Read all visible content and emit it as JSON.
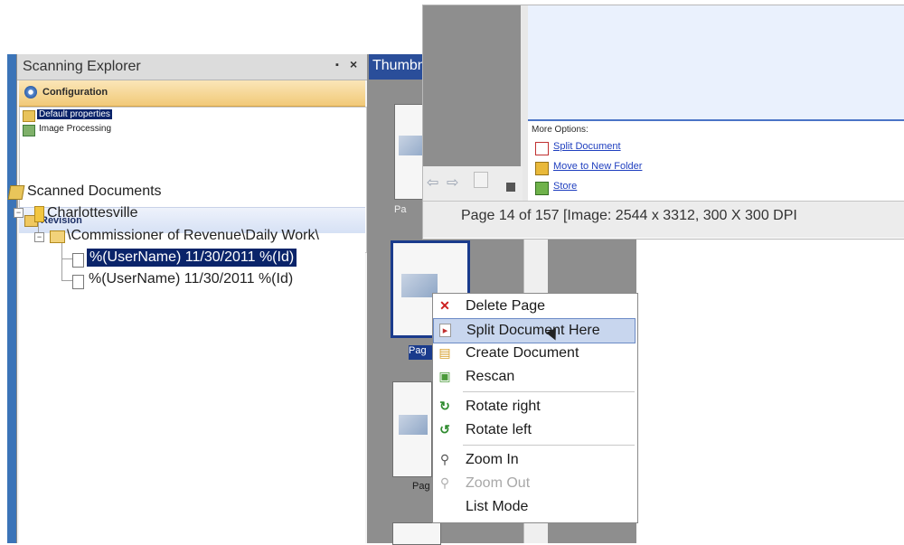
{
  "explorer": {
    "title": "Scanning Explorer",
    "pin_glyph": "▪",
    "close_glyph": "×",
    "configuration": {
      "label": "Configuration",
      "items": [
        {
          "label": "Default properties",
          "selected": true
        },
        {
          "label": "Image Processing",
          "selected": false
        }
      ]
    },
    "revision": {
      "label": "Revision",
      "tree": {
        "root": "Scanned Documents",
        "level1": "Charlottesville",
        "level2": "\\Commissioner of Revenue\\Daily Work\\",
        "documents": [
          {
            "label": "%(UserName) 11/30/2011 %(Id)",
            "selected": true
          },
          {
            "label": "%(UserName) 11/30/2011 %(Id)",
            "selected": false
          }
        ]
      }
    },
    "expander_glyph": "−"
  },
  "thumbnails": {
    "title": "Thumbnails",
    "labels": [
      "Pa",
      "Pag",
      "Pag"
    ]
  },
  "context_menu": {
    "items": [
      {
        "label": "Delete Page",
        "icon": "delete-x-icon",
        "glyph": "✕",
        "color": "#cc1f1f"
      },
      {
        "label": "Split Document Here",
        "icon": "split-document-icon",
        "glyph": "▸",
        "color": "#c03030",
        "highlighted": true
      },
      {
        "label": "Create Document",
        "icon": "create-document-icon",
        "glyph": "▤",
        "color": "#d6a02e"
      },
      {
        "label": "Rescan",
        "icon": "rescan-icon",
        "glyph": "▣",
        "color": "#4a9a3a"
      },
      {
        "label": "Rotate right",
        "icon": "rotate-right-icon",
        "glyph": "↻",
        "color": "#2e8a2e"
      },
      {
        "label": "Rotate left",
        "icon": "rotate-left-icon",
        "glyph": "↺",
        "color": "#2e8a2e"
      },
      {
        "label": "Zoom In",
        "icon": "zoom-in-icon",
        "glyph": "⚲",
        "color": "#555555"
      },
      {
        "label": "Zoom Out",
        "icon": "zoom-out-icon",
        "glyph": "⚲",
        "color": "#b0b0b0",
        "disabled": true
      },
      {
        "label": "List Mode",
        "icon": "",
        "glyph": "",
        "color": "#000000"
      }
    ]
  },
  "more_options": {
    "heading": "More Options:",
    "links": [
      "Split Document",
      "Move to New Folder",
      "Store"
    ]
  },
  "navigation": {
    "back_glyph": "⇦",
    "forward_glyph": "⇨"
  },
  "status": {
    "text": "Page 14 of 157   [Image: 2544 x 3312, 300 X 300 DPI"
  }
}
